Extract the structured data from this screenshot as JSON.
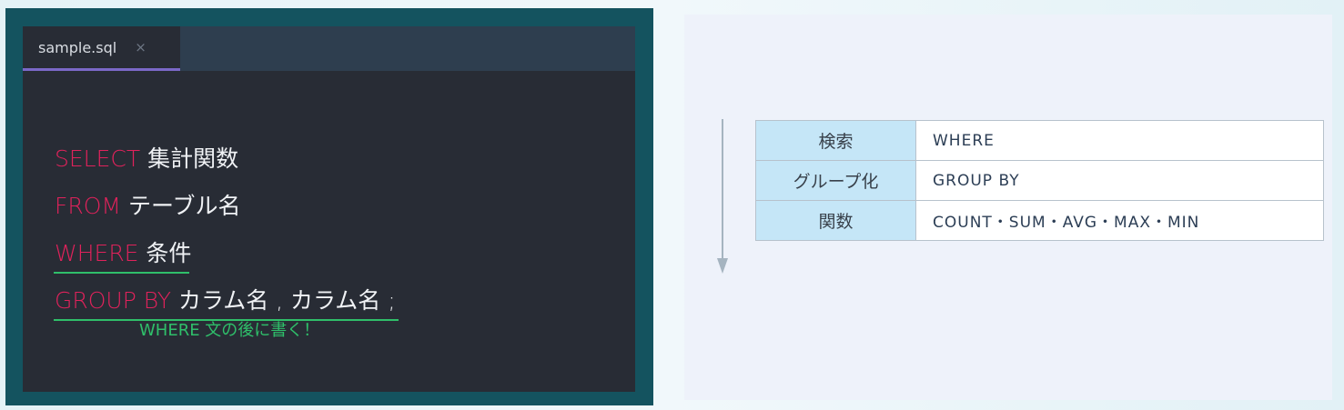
{
  "editor": {
    "tab_label": "sample.sql",
    "tab_close": "×",
    "lines": [
      {
        "keyword": "SELECT",
        "rest": " 集計関数"
      },
      {
        "keyword": "FROM",
        "rest": " テーブル名"
      },
      {
        "keyword": "WHERE",
        "rest": " 条件"
      },
      {
        "keyword": "GROUP BY",
        "rest": " カラム名 , カラム名 ;"
      }
    ],
    "note": "WHERE 文の後に書く！",
    "colors": {
      "keyword": "#e0225b",
      "underline": "#2fbf6a",
      "tab_indicator": "#7b68c8"
    }
  },
  "table": {
    "rows": [
      {
        "label": "検索",
        "value": "WHERE"
      },
      {
        "label": "グループ化",
        "value": "GROUP BY"
      },
      {
        "label": "関数",
        "value": "COUNT・SUM・AVG・MAX・MIN"
      }
    ]
  },
  "arrow": {
    "icon": "down-arrow-icon"
  }
}
